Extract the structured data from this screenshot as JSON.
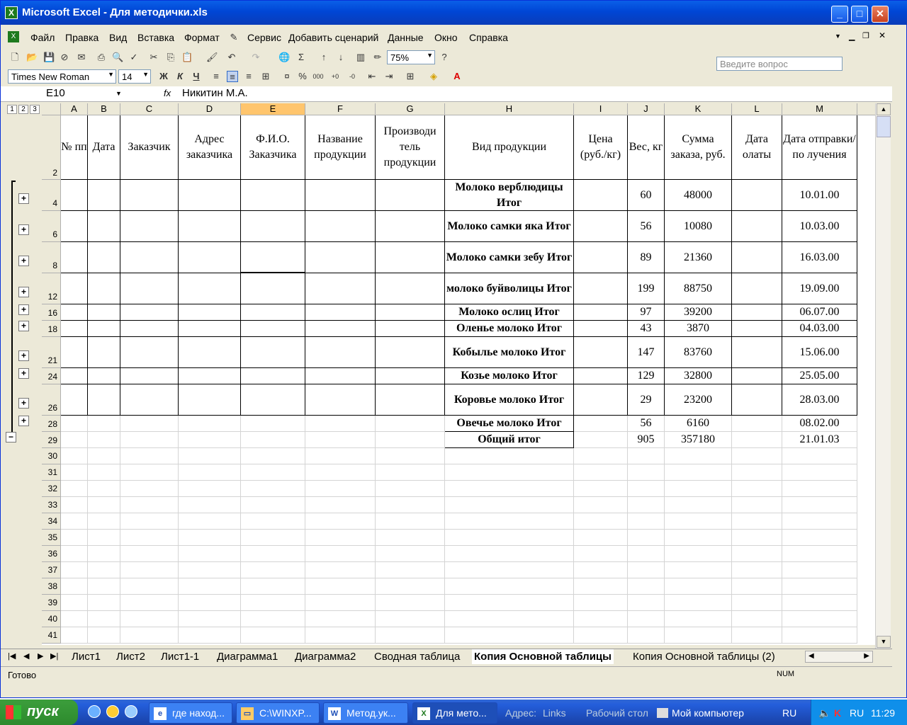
{
  "window": {
    "title": "Microsoft Excel - Для методички.xls"
  },
  "menu": [
    "Файл",
    "Правка",
    "Вид",
    "Вставка",
    "Формат",
    "Сервис",
    "Добавить сценарий",
    "Данные",
    "Окно",
    "Справка"
  ],
  "ask_placeholder": "Введите вопрос",
  "toolbar": {
    "zoom": "75%",
    "font": "Times New Roman",
    "size": "14",
    "bold_label": "Ж",
    "italic_label": "К",
    "underline_label": "Ч"
  },
  "formula_bar": {
    "cell": "E10",
    "fx": "fx",
    "value": "Никитин М.А."
  },
  "outline_levels": [
    "1",
    "2",
    "3"
  ],
  "columns": [
    "A",
    "B",
    "C",
    "D",
    "E",
    "F",
    "G",
    "H",
    "I",
    "J",
    "K",
    "L",
    "M"
  ],
  "header_row": {
    "row": "2",
    "cells": [
      "№ пп",
      "Дата",
      "Заказчик",
      "Адрес заказчика",
      "Ф.И.О. Заказчика",
      "Название продукции",
      "Производитель продукции",
      "Вид продукции",
      "Цена (руб./кг)",
      "Вес, кг",
      "Сумма заказа, руб.",
      "Дата олаты",
      "Дата отправки/получения"
    ]
  },
  "header_display": {
    "G": "Производи тель продукции",
    "M": "Дата отправки/по лучения"
  },
  "rows": [
    {
      "row": "4",
      "product": "Молоко верблюдицы Итог",
      "weight": "60",
      "sum": "48000",
      "date": "10.01.00"
    },
    {
      "row": "6",
      "product": "Молоко самки яка Итог",
      "weight": "56",
      "sum": "10080",
      "date": "10.03.00"
    },
    {
      "row": "8",
      "product": "Молоко самки зебу Итог",
      "weight": "89",
      "sum": "21360",
      "date": "16.03.00"
    },
    {
      "row": "12",
      "product": "молоко буйволицы Итог",
      "weight": "199",
      "sum": "88750",
      "date": "19.09.00"
    },
    {
      "row": "16",
      "product": "Молоко ослиц Итог",
      "weight": "97",
      "sum": "39200",
      "date": "06.07.00"
    },
    {
      "row": "18",
      "product": "Оленье молоко Итог",
      "weight": "43",
      "sum": "3870",
      "date": "04.03.00"
    },
    {
      "row": "21",
      "product": "Кобылье молоко Итог",
      "weight": "147",
      "sum": "83760",
      "date": "15.06.00"
    },
    {
      "row": "24",
      "product": "Козье молоко Итог",
      "weight": "129",
      "sum": "32800",
      "date": "25.05.00"
    },
    {
      "row": "26",
      "product": "Коровье молоко Итог",
      "weight": "29",
      "sum": "23200",
      "date": "28.03.00"
    },
    {
      "row": "28",
      "product": "Овечье молоко Итог",
      "weight": "56",
      "sum": "6160",
      "date": "08.02.00"
    },
    {
      "row": "29",
      "product": "Общий итог",
      "weight": "905",
      "sum": "357180",
      "date": "21.01.03"
    }
  ],
  "empty_rows": [
    "30",
    "31",
    "32",
    "33",
    "34",
    "35",
    "36",
    "37",
    "38",
    "39",
    "40",
    "41"
  ],
  "sheet_tabs": [
    "Лист1",
    "Лист2",
    "Лист1-1",
    "Диаграмма1",
    "Диаграмма2",
    "Сводная таблица",
    "Копия Основной таблицы",
    "Копия Основной таблицы (2)"
  ],
  "active_tab": "Копия Основной таблицы",
  "status": {
    "left": "Готово",
    "num": "NUM"
  },
  "taskbar": {
    "start": "пуск",
    "tasks": [
      "где наход...",
      "C:\\WINXP...",
      "Метод.ук...",
      "Для мето..."
    ],
    "address_label": "Адрес:",
    "links": "Links",
    "desktop": "Рабочий стол",
    "mycomputer": "Мой компьютер",
    "lang": "RU",
    "tray_lang": "RU",
    "clock": "11:29"
  }
}
